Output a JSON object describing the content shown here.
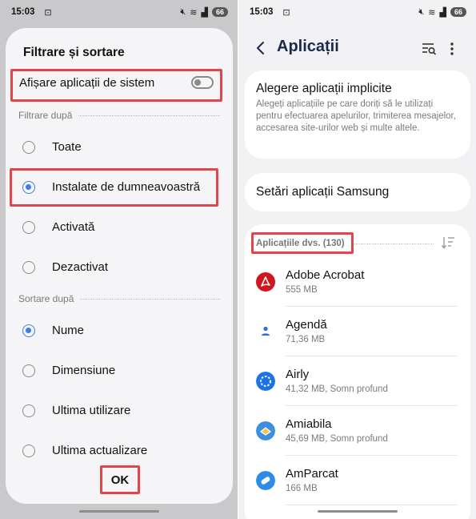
{
  "left_screen": {
    "status_bar": {
      "time": "15:03",
      "battery": "66"
    },
    "dialog": {
      "title": "Filtrare și sortare",
      "system_apps_toggle": {
        "label": "Afișare aplicații de sistem",
        "on": false
      },
      "filter_section": "Filtrare după",
      "filter_options": [
        {
          "label": "Toate",
          "selected": false
        },
        {
          "label": "Instalate de dumneavoastră",
          "selected": true
        },
        {
          "label": "Activată",
          "selected": false
        },
        {
          "label": "Dezactivat",
          "selected": false
        }
      ],
      "sort_section": "Sortare după",
      "sort_options": [
        {
          "label": "Nume",
          "selected": true
        },
        {
          "label": "Dimensiune",
          "selected": false
        },
        {
          "label": "Ultima utilizare",
          "selected": false
        },
        {
          "label": "Ultima actualizare",
          "selected": false
        }
      ],
      "ok_label": "OK"
    }
  },
  "right_screen": {
    "status_bar": {
      "time": "15:03",
      "battery": "66"
    },
    "header": {
      "title": "Aplicații"
    },
    "default_apps": {
      "title": "Alegere aplicații implicite",
      "description": "Alegeți aplicațiile pe care doriți să le utilizați pentru efectuarea apelurilor, trimiterea mesajelor, accesarea site-urilor web și multe altele."
    },
    "samsung_settings": {
      "title": "Setări aplicații Samsung"
    },
    "apps_section": {
      "heading": "Aplicațiile dvs. (130)"
    },
    "apps": [
      {
        "name": "Adobe Acrobat",
        "meta": "555 MB",
        "icon": "adobe-acrobat-icon",
        "color": "#d0171f"
      },
      {
        "name": "Agendă",
        "meta": "71,36 MB",
        "icon": "agenda-icon",
        "color": "#2a6fdb"
      },
      {
        "name": "Airly",
        "meta": "41,32 MB, Somn profund",
        "icon": "airly-icon",
        "color": "#1a73e8"
      },
      {
        "name": "Amiabila",
        "meta": "45,69 MB, Somn profund",
        "icon": "amiabila-icon",
        "color": "#3b8ee0"
      },
      {
        "name": "AmParcat",
        "meta": "166 MB",
        "icon": "amparcat-icon",
        "color": "#2c8de8"
      }
    ]
  },
  "highlight_color": "#e0464b",
  "accent_color": "#3e7ee0"
}
